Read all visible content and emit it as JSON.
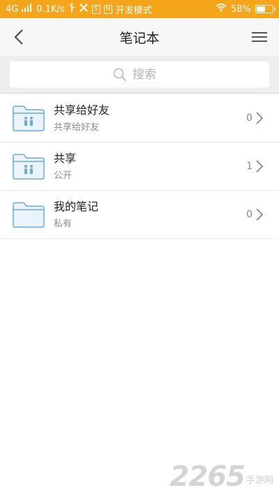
{
  "status_bar": {
    "network": "4G",
    "speed": "0.1K/s",
    "app_icon_s": "S",
    "app_icon_n": "N",
    "dev_mode": "开发模式",
    "battery_percent": "58%",
    "battery_level": 0.58
  },
  "nav": {
    "title": "笔记本"
  },
  "search": {
    "placeholder": "搜索"
  },
  "notebooks": [
    {
      "title": "共享给好友",
      "subtitle": "共享给好友",
      "count": "0",
      "icon": "shared-folder-icon"
    },
    {
      "title": "共享",
      "subtitle": "公开",
      "count": "1",
      "icon": "shared-folder-icon"
    },
    {
      "title": "我的笔记",
      "subtitle": "私有",
      "count": "0",
      "icon": "folder-icon"
    }
  ],
  "watermark": {
    "number": "2265",
    "text": "手游网"
  },
  "colors": {
    "status_bar": "#f4a51c",
    "folder_blue": "#6fa8dc",
    "accent_text": "#222222"
  }
}
